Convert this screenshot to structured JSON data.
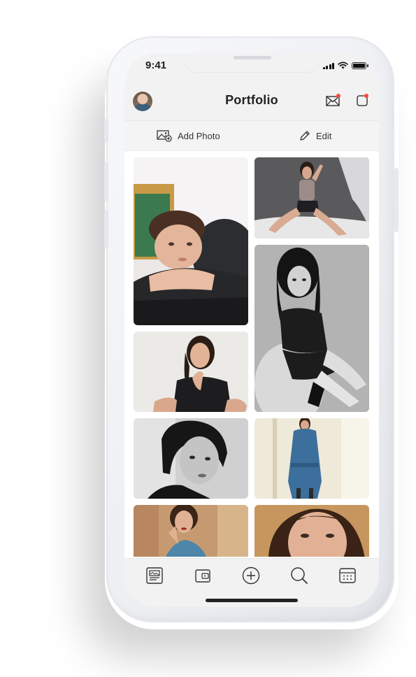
{
  "status_bar": {
    "time": "9:41"
  },
  "header": {
    "title": "Portfolio",
    "icons": [
      "avatar",
      "mail-icon",
      "notification-icon"
    ],
    "badge_color": "#ff4538"
  },
  "actions": {
    "add_photo_label": "Add Photo",
    "edit_label": "Edit"
  },
  "photos": [
    {
      "alt": "woman resting head on arms",
      "tone": "color"
    },
    {
      "alt": "woman sitting on floor",
      "tone": "color"
    },
    {
      "alt": "woman seated in chair",
      "tone": "black-and-white"
    },
    {
      "alt": "woman sitting, hand at chin",
      "tone": "color"
    },
    {
      "alt": "woman portrait with bob haircut",
      "tone": "black-and-white"
    },
    {
      "alt": "woman in blue coat",
      "tone": "color"
    },
    {
      "alt": "woman in blue jacket",
      "tone": "color"
    },
    {
      "alt": "woman close-up portrait",
      "tone": "color"
    }
  ],
  "bottom_tabs": [
    "portfolio-icon",
    "wallet-icon",
    "add-icon",
    "search-icon",
    "calendar-icon"
  ],
  "colors": {
    "background": "#ffffff",
    "bar": "#f2f2f3",
    "accent": "#ff4538"
  }
}
